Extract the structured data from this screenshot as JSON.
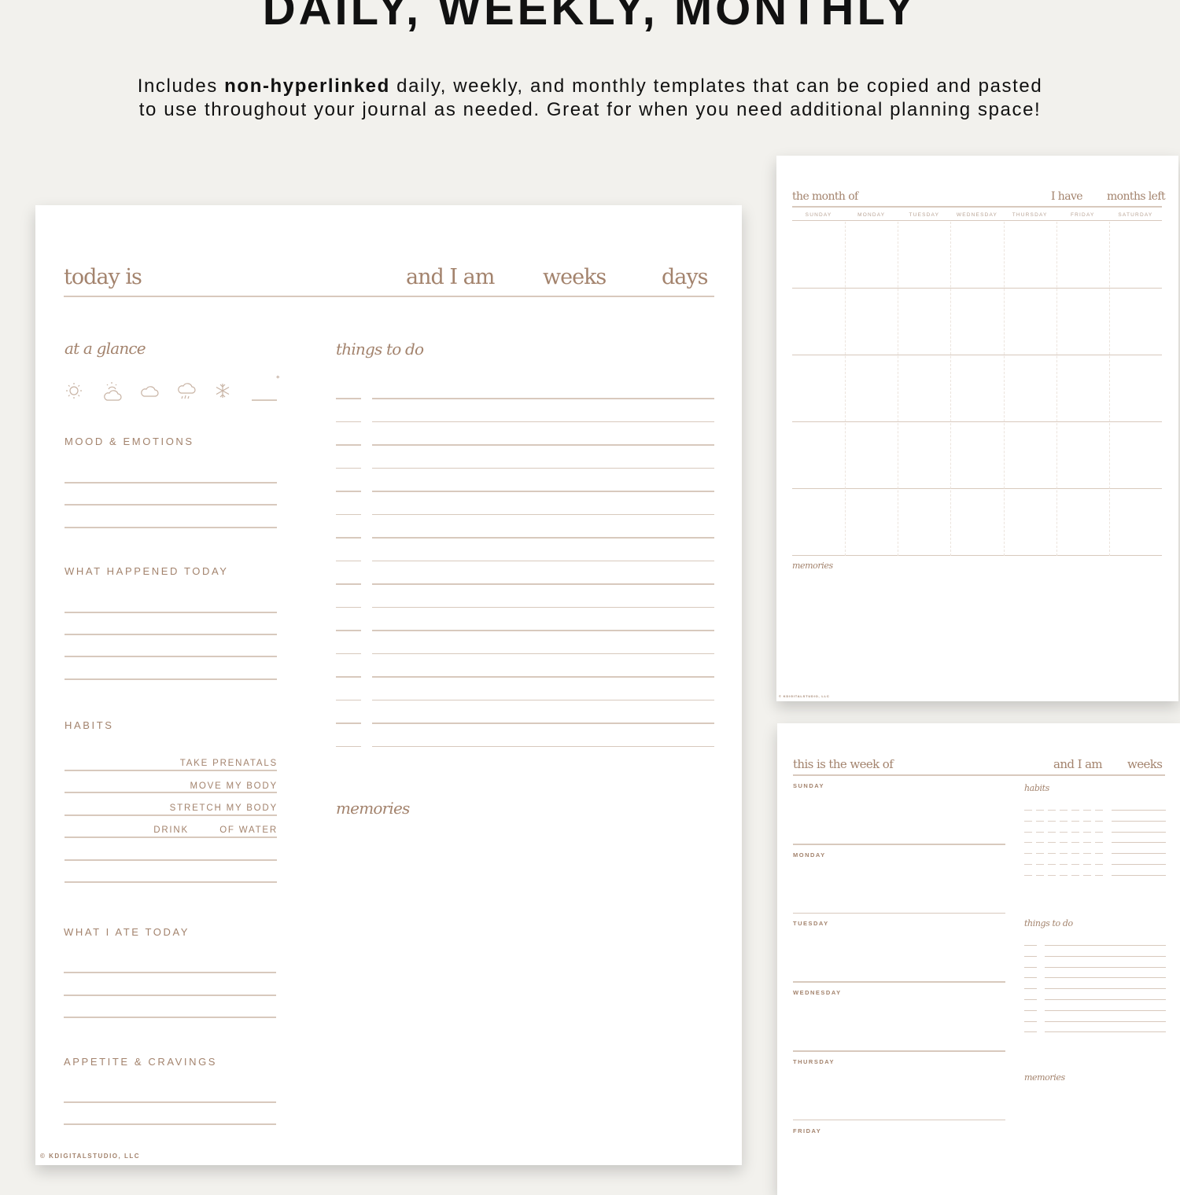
{
  "hero": {
    "title": "DAILY, WEEKLY, MONTHLY",
    "subtitle_pre": "Includes ",
    "subtitle_bold": "non-hyperlinked",
    "subtitle_post": " daily, weekly, and monthly templates that can be copied and pasted",
    "subtitle_line2": "to use throughout your journal as needed. Great for when you need additional planning space!"
  },
  "colors": {
    "background": "#f2f1ed",
    "accent_text": "#a3836d",
    "rule": "#d8c9bd",
    "page": "#ffffff",
    "title": "#111111"
  },
  "daily": {
    "header": {
      "today_is": "today is",
      "and_i_am": "and I am",
      "weeks": "weeks",
      "days": "days"
    },
    "at_a_glance": "at a glance",
    "weather_icons": [
      "sun-icon",
      "partly-cloudy-icon",
      "cloud-icon",
      "storm-icon",
      "snowflake-icon"
    ],
    "temperature_degree": "°",
    "mood_title": "MOOD & EMOTIONS",
    "happened_title": "WHAT HAPPENED TODAY",
    "habits_title": "HABITS",
    "habits": [
      "TAKE PRENATALS",
      "MOVE MY BODY",
      "STRETCH MY BODY"
    ],
    "water_habit": {
      "drink": "DRINK",
      "of_water": "OF WATER"
    },
    "ate_title": "WHAT I ATE TODAY",
    "appetite_title": "APPETITE & CRAVINGS",
    "todo_title": "things to do",
    "todo_count": 16,
    "memories_title": "memories",
    "copyright": "© KDIGITALSTUDIO, LLC"
  },
  "monthly": {
    "header": {
      "month_of": "the month of",
      "i_have": "I have",
      "months_left": "months left"
    },
    "days": [
      "SUNDAY",
      "MONDAY",
      "TUESDAY",
      "WEDNESDAY",
      "THURSDAY",
      "FRIDAY",
      "SATURDAY"
    ],
    "week_rows": 5,
    "memories_title": "memories",
    "copyright": "© KDIGITALSTUDIO, LLC"
  },
  "weekly": {
    "header": {
      "week_of": "this is the week of",
      "and_i_am": "and I am",
      "weeks": "weeks"
    },
    "days": [
      "SUNDAY",
      "MONDAY",
      "TUESDAY",
      "WEDNESDAY",
      "THURSDAY",
      "FRIDAY"
    ],
    "habits_title": "habits",
    "habit_rows": 7,
    "todo_title": "things to do",
    "todo_count": 9,
    "memories_title": "memories"
  }
}
